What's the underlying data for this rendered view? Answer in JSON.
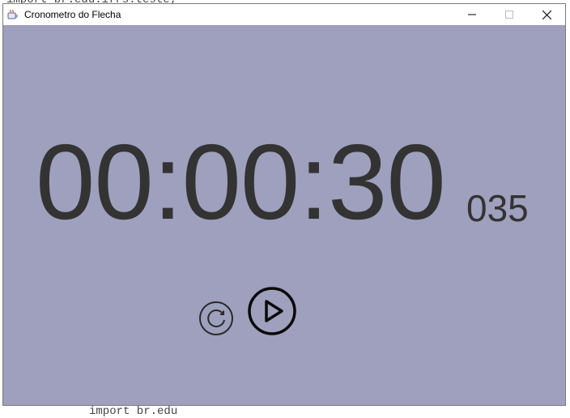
{
  "background": {
    "top_text": "import br.edu.ifrs.teste;",
    "bottom_text": "import br.edu"
  },
  "window": {
    "title": "Cronometro do Flecha",
    "background_color": "#9ea0bd",
    "controls": {
      "minimize_icon": "minimize-icon",
      "maximize_icon": "maximize-icon",
      "close_icon": "close-icon"
    }
  },
  "timer": {
    "main": "00:00:30",
    "milliseconds": "035",
    "text_color": "#333333"
  },
  "buttons": {
    "reset_icon": "reset-icon",
    "play_icon": "play-icon"
  }
}
